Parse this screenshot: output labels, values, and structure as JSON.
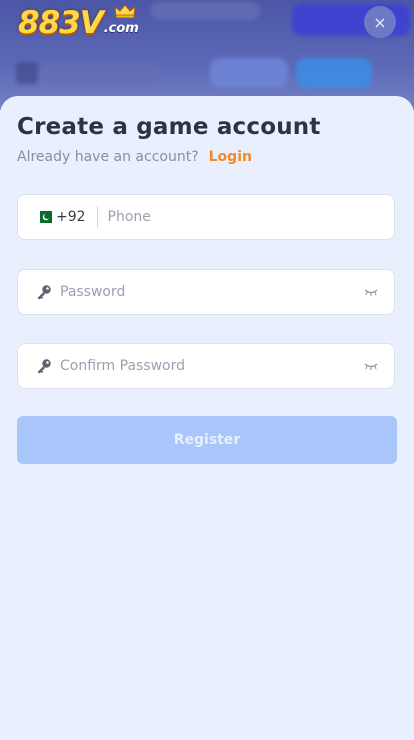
{
  "logo": {
    "main": "883V",
    "suffix": ".com"
  },
  "close_icon": "×",
  "title": "Create a game account",
  "subtitle": {
    "text": "Already have an account?",
    "login_link": "Login"
  },
  "phone_field": {
    "country_code": "+92",
    "placeholder": "Phone",
    "flag": "pakistan-flag"
  },
  "password_field": {
    "placeholder": "Password"
  },
  "confirm_field": {
    "placeholder": "Confirm Password"
  },
  "register_label": "Register",
  "colors": {
    "accent_link": "#f08a28",
    "register_bg": "#a9c6fb",
    "sheet_bg": "#e9effc",
    "title": "#2f3240"
  }
}
